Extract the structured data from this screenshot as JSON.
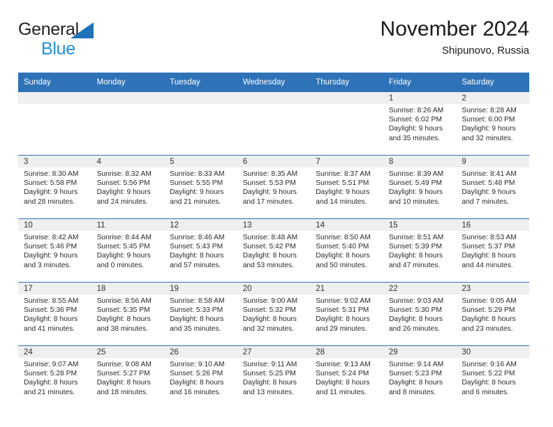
{
  "brand": {
    "name_part1": "General",
    "name_part2": "Blue",
    "triangle_color": "#1f72b8",
    "blue_text_color": "#1f8fe0"
  },
  "header": {
    "title": "November 2024",
    "subtitle": "Shipunovo, Russia"
  },
  "theme": {
    "header_blue": "#2e72b8",
    "date_band_gray": "#efefef",
    "text_color": "#2b2b2b"
  },
  "calendar": {
    "weekday_headers": [
      "Sunday",
      "Monday",
      "Tuesday",
      "Wednesday",
      "Thursday",
      "Friday",
      "Saturday"
    ],
    "weeks": [
      [
        {
          "day": "",
          "sunrise": "",
          "sunset": "",
          "daylight_line1": "",
          "daylight_line2": "",
          "empty": true
        },
        {
          "day": "",
          "sunrise": "",
          "sunset": "",
          "daylight_line1": "",
          "daylight_line2": "",
          "empty": true
        },
        {
          "day": "",
          "sunrise": "",
          "sunset": "",
          "daylight_line1": "",
          "daylight_line2": "",
          "empty": true
        },
        {
          "day": "",
          "sunrise": "",
          "sunset": "",
          "daylight_line1": "",
          "daylight_line2": "",
          "empty": true
        },
        {
          "day": "",
          "sunrise": "",
          "sunset": "",
          "daylight_line1": "",
          "daylight_line2": "",
          "empty": true
        },
        {
          "day": "1",
          "sunrise": "Sunrise: 8:26 AM",
          "sunset": "Sunset: 6:02 PM",
          "daylight_line1": "Daylight: 9 hours",
          "daylight_line2": "and 35 minutes.",
          "empty": false
        },
        {
          "day": "2",
          "sunrise": "Sunrise: 8:28 AM",
          "sunset": "Sunset: 6:00 PM",
          "daylight_line1": "Daylight: 9 hours",
          "daylight_line2": "and 32 minutes.",
          "empty": false
        }
      ],
      [
        {
          "day": "3",
          "sunrise": "Sunrise: 8:30 AM",
          "sunset": "Sunset: 5:58 PM",
          "daylight_line1": "Daylight: 9 hours",
          "daylight_line2": "and 28 minutes.",
          "empty": false
        },
        {
          "day": "4",
          "sunrise": "Sunrise: 8:32 AM",
          "sunset": "Sunset: 5:56 PM",
          "daylight_line1": "Daylight: 9 hours",
          "daylight_line2": "and 24 minutes.",
          "empty": false
        },
        {
          "day": "5",
          "sunrise": "Sunrise: 8:33 AM",
          "sunset": "Sunset: 5:55 PM",
          "daylight_line1": "Daylight: 9 hours",
          "daylight_line2": "and 21 minutes.",
          "empty": false
        },
        {
          "day": "6",
          "sunrise": "Sunrise: 8:35 AM",
          "sunset": "Sunset: 5:53 PM",
          "daylight_line1": "Daylight: 9 hours",
          "daylight_line2": "and 17 minutes.",
          "empty": false
        },
        {
          "day": "7",
          "sunrise": "Sunrise: 8:37 AM",
          "sunset": "Sunset: 5:51 PM",
          "daylight_line1": "Daylight: 9 hours",
          "daylight_line2": "and 14 minutes.",
          "empty": false
        },
        {
          "day": "8",
          "sunrise": "Sunrise: 8:39 AM",
          "sunset": "Sunset: 5:49 PM",
          "daylight_line1": "Daylight: 9 hours",
          "daylight_line2": "and 10 minutes.",
          "empty": false
        },
        {
          "day": "9",
          "sunrise": "Sunrise: 8:41 AM",
          "sunset": "Sunset: 5:48 PM",
          "daylight_line1": "Daylight: 9 hours",
          "daylight_line2": "and 7 minutes.",
          "empty": false
        }
      ],
      [
        {
          "day": "10",
          "sunrise": "Sunrise: 8:42 AM",
          "sunset": "Sunset: 5:46 PM",
          "daylight_line1": "Daylight: 9 hours",
          "daylight_line2": "and 3 minutes.",
          "empty": false
        },
        {
          "day": "11",
          "sunrise": "Sunrise: 8:44 AM",
          "sunset": "Sunset: 5:45 PM",
          "daylight_line1": "Daylight: 9 hours",
          "daylight_line2": "and 0 minutes.",
          "empty": false
        },
        {
          "day": "12",
          "sunrise": "Sunrise: 8:46 AM",
          "sunset": "Sunset: 5:43 PM",
          "daylight_line1": "Daylight: 8 hours",
          "daylight_line2": "and 57 minutes.",
          "empty": false
        },
        {
          "day": "13",
          "sunrise": "Sunrise: 8:48 AM",
          "sunset": "Sunset: 5:42 PM",
          "daylight_line1": "Daylight: 8 hours",
          "daylight_line2": "and 53 minutes.",
          "empty": false
        },
        {
          "day": "14",
          "sunrise": "Sunrise: 8:50 AM",
          "sunset": "Sunset: 5:40 PM",
          "daylight_line1": "Daylight: 8 hours",
          "daylight_line2": "and 50 minutes.",
          "empty": false
        },
        {
          "day": "15",
          "sunrise": "Sunrise: 8:51 AM",
          "sunset": "Sunset: 5:39 PM",
          "daylight_line1": "Daylight: 8 hours",
          "daylight_line2": "and 47 minutes.",
          "empty": false
        },
        {
          "day": "16",
          "sunrise": "Sunrise: 8:53 AM",
          "sunset": "Sunset: 5:37 PM",
          "daylight_line1": "Daylight: 8 hours",
          "daylight_line2": "and 44 minutes.",
          "empty": false
        }
      ],
      [
        {
          "day": "17",
          "sunrise": "Sunrise: 8:55 AM",
          "sunset": "Sunset: 5:36 PM",
          "daylight_line1": "Daylight: 8 hours",
          "daylight_line2": "and 41 minutes.",
          "empty": false
        },
        {
          "day": "18",
          "sunrise": "Sunrise: 8:56 AM",
          "sunset": "Sunset: 5:35 PM",
          "daylight_line1": "Daylight: 8 hours",
          "daylight_line2": "and 38 minutes.",
          "empty": false
        },
        {
          "day": "19",
          "sunrise": "Sunrise: 8:58 AM",
          "sunset": "Sunset: 5:33 PM",
          "daylight_line1": "Daylight: 8 hours",
          "daylight_line2": "and 35 minutes.",
          "empty": false
        },
        {
          "day": "20",
          "sunrise": "Sunrise: 9:00 AM",
          "sunset": "Sunset: 5:32 PM",
          "daylight_line1": "Daylight: 8 hours",
          "daylight_line2": "and 32 minutes.",
          "empty": false
        },
        {
          "day": "21",
          "sunrise": "Sunrise: 9:02 AM",
          "sunset": "Sunset: 5:31 PM",
          "daylight_line1": "Daylight: 8 hours",
          "daylight_line2": "and 29 minutes.",
          "empty": false
        },
        {
          "day": "22",
          "sunrise": "Sunrise: 9:03 AM",
          "sunset": "Sunset: 5:30 PM",
          "daylight_line1": "Daylight: 8 hours",
          "daylight_line2": "and 26 minutes.",
          "empty": false
        },
        {
          "day": "23",
          "sunrise": "Sunrise: 9:05 AM",
          "sunset": "Sunset: 5:29 PM",
          "daylight_line1": "Daylight: 8 hours",
          "daylight_line2": "and 23 minutes.",
          "empty": false
        }
      ],
      [
        {
          "day": "24",
          "sunrise": "Sunrise: 9:07 AM",
          "sunset": "Sunset: 5:28 PM",
          "daylight_line1": "Daylight: 8 hours",
          "daylight_line2": "and 21 minutes.",
          "empty": false
        },
        {
          "day": "25",
          "sunrise": "Sunrise: 9:08 AM",
          "sunset": "Sunset: 5:27 PM",
          "daylight_line1": "Daylight: 8 hours",
          "daylight_line2": "and 18 minutes.",
          "empty": false
        },
        {
          "day": "26",
          "sunrise": "Sunrise: 9:10 AM",
          "sunset": "Sunset: 5:26 PM",
          "daylight_line1": "Daylight: 8 hours",
          "daylight_line2": "and 16 minutes.",
          "empty": false
        },
        {
          "day": "27",
          "sunrise": "Sunrise: 9:11 AM",
          "sunset": "Sunset: 5:25 PM",
          "daylight_line1": "Daylight: 8 hours",
          "daylight_line2": "and 13 minutes.",
          "empty": false
        },
        {
          "day": "28",
          "sunrise": "Sunrise: 9:13 AM",
          "sunset": "Sunset: 5:24 PM",
          "daylight_line1": "Daylight: 8 hours",
          "daylight_line2": "and 11 minutes.",
          "empty": false
        },
        {
          "day": "29",
          "sunrise": "Sunrise: 9:14 AM",
          "sunset": "Sunset: 5:23 PM",
          "daylight_line1": "Daylight: 8 hours",
          "daylight_line2": "and 8 minutes.",
          "empty": false
        },
        {
          "day": "30",
          "sunrise": "Sunrise: 9:16 AM",
          "sunset": "Sunset: 5:22 PM",
          "daylight_line1": "Daylight: 8 hours",
          "daylight_line2": "and 6 minutes.",
          "empty": false
        }
      ]
    ]
  }
}
